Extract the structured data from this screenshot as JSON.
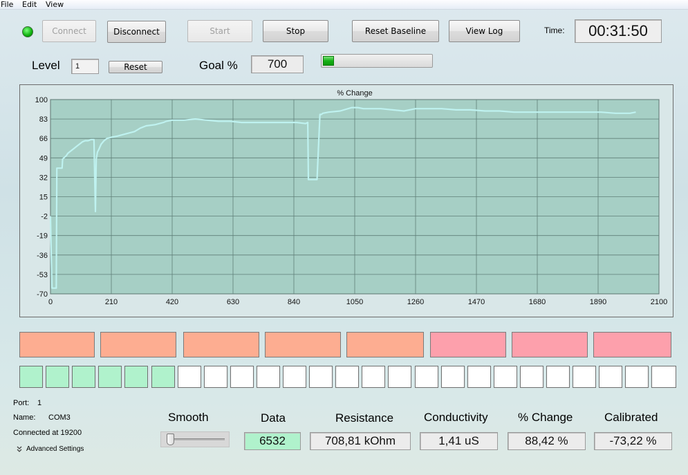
{
  "menu": [
    "File",
    "Edit",
    "View"
  ],
  "toolbar": {
    "connect": "Connect",
    "disconnect": "Disconnect",
    "start": "Start",
    "stop": "Stop",
    "reset_baseline": "Reset Baseline",
    "view_log": "View Log",
    "time_label": "Time:",
    "time_value": "00:31:50",
    "connection_status_color": "#0db00d"
  },
  "level": {
    "label": "Level",
    "value": "1",
    "reset": "Reset"
  },
  "goal": {
    "label": "Goal %",
    "value": "700",
    "progress_fraction": 0.1
  },
  "chart_data": {
    "type": "line",
    "title": "% Change",
    "xlim": [
      0,
      2100
    ],
    "ylim": [
      -70,
      100
    ],
    "x_ticks": [
      0,
      210,
      420,
      630,
      840,
      1050,
      1260,
      1470,
      1680,
      1890,
      2100
    ],
    "y_ticks": [
      100,
      83,
      66,
      49,
      32,
      15,
      -2,
      -19,
      -36,
      -53,
      -70
    ],
    "grid": true,
    "line_color": "#bff2f0",
    "plot_bg": "#a6cfc5",
    "series": [
      {
        "x": [
          0,
          5,
          8,
          20,
          22,
          40,
          42,
          55,
          60,
          70,
          80,
          90,
          100,
          110,
          120,
          130,
          140,
          150,
          155,
          158,
          162,
          168,
          175,
          185,
          195,
          210,
          230,
          260,
          290,
          310,
          330,
          360,
          390,
          400,
          420,
          460,
          500,
          540,
          580,
          620,
          660,
          700,
          740,
          780,
          820,
          850,
          880,
          888,
          890,
          910,
          920,
          930,
          935,
          940,
          960,
          1000,
          1040,
          1060,
          1080,
          1100,
          1140,
          1180,
          1220,
          1260,
          1300,
          1350,
          1400,
          1450,
          1500,
          1550,
          1600,
          1650,
          1700,
          1750,
          1800,
          1850,
          1900,
          1950,
          2000,
          2020
        ],
        "y": [
          -2,
          -65,
          -65,
          -65,
          40,
          40,
          48,
          51,
          53,
          55,
          57,
          59,
          61,
          63,
          64,
          64,
          65,
          65,
          2,
          48,
          54,
          57,
          61,
          64,
          66,
          67,
          68,
          70,
          72,
          75,
          77,
          78,
          80,
          81,
          82,
          82,
          83,
          82,
          81,
          81,
          80,
          80,
          80,
          80,
          80,
          80,
          79,
          80,
          30,
          30,
          30,
          87,
          87,
          88,
          89,
          90,
          93,
          93,
          92,
          92,
          92,
          91,
          90,
          92,
          92,
          92,
          91,
          91,
          90,
          90,
          89,
          89,
          89,
          89,
          89,
          89,
          89,
          88,
          88,
          89
        ]
      }
    ]
  },
  "indicators": {
    "colors": [
      "#fdad91",
      "#fdad91",
      "#fdad91",
      "#fdad91",
      "#fdad91",
      "#fda0ac",
      "#fda0ac",
      "#fda0ac"
    ],
    "squares_on_color": "#b0f2cc",
    "squares_off_color": "#ffffff",
    "squares_total": 25,
    "squares_on": 6
  },
  "port_info": {
    "port_label": "Port:",
    "port_value": "1",
    "name_label": "Name:",
    "name_value": "COM3",
    "connected_text": "Connected at 19200",
    "advanced_settings": "Advanced Settings"
  },
  "smooth": {
    "label": "Smooth",
    "level_fraction": 0.0
  },
  "readouts": [
    {
      "label": "Data",
      "value": "6532",
      "highlight": "#b0f2cc"
    },
    {
      "label": "Resistance",
      "value": "708,81 kOhm",
      "highlight": ""
    },
    {
      "label": "Conductivity",
      "value": "1,41 uS",
      "highlight": ""
    },
    {
      "label": "% Change",
      "value": "88,42 %",
      "highlight": ""
    },
    {
      "label": "Calibrated",
      "value": "-73,22 %",
      "highlight": ""
    }
  ]
}
